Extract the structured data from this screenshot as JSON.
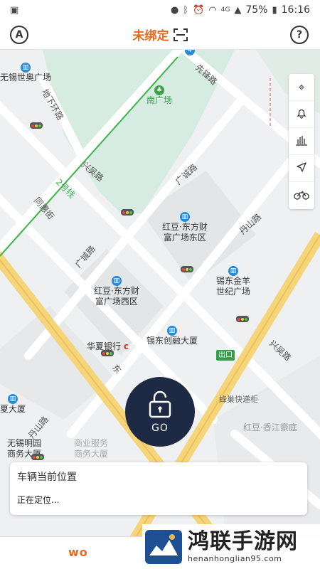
{
  "status_bar": {
    "battery": "75%",
    "time": "16:16",
    "network": "4G"
  },
  "header": {
    "left_icon_letter": "A",
    "title": "未绑定",
    "right_icon": "?"
  },
  "map": {
    "roads": [
      "先锋路",
      "地下环路",
      "兴吴路",
      "2号线",
      "同惠街",
      "广诚路",
      "丹山路",
      "广城路",
      "东",
      "兴吴路",
      "丹山路"
    ],
    "pois": {
      "wuxi_sports": "无锡世奥广场",
      "south_square": "南广场",
      "hongdou_east": [
        "红豆·东方财",
        "富广场东区"
      ],
      "hongdou_west": [
        "红豆·东方财",
        "富广场西区"
      ],
      "xidong_jinyang": [
        "锡东金羊",
        "世纪广场"
      ],
      "xidong_chuangrong": "锡东创融大厦",
      "huaxia_bank": "华夏银行",
      "exit": "出口",
      "fengchao": "蜂巢快递柜",
      "hongdou_haoting": "红豆·香江豪庭",
      "xia_building": "夏大厦",
      "mingyuan": [
        "无锡明园",
        "商务大厦"
      ],
      "business_bldg": [
        "商业服务",
        "商务大厦"
      ]
    }
  },
  "toolbar": {
    "icons": [
      "locate-icon",
      "bell-icon",
      "chart-icon",
      "navigate-icon",
      "motorcycle-icon"
    ]
  },
  "go_button": {
    "label": "GO"
  },
  "location_card": {
    "title": "车辆当前位置",
    "status": "正在定位..."
  },
  "bottom_bar": {
    "brand": "wo"
  },
  "watermark": {
    "main": "鸿联手游网",
    "url": "henanhonglian95.com"
  },
  "colors": {
    "accent": "#e86a1f",
    "go_bg": "#1e2a44",
    "major_road": "#f6d57a",
    "metro_line": "#3cb44b",
    "poi_blue": "#2a8bd1"
  }
}
